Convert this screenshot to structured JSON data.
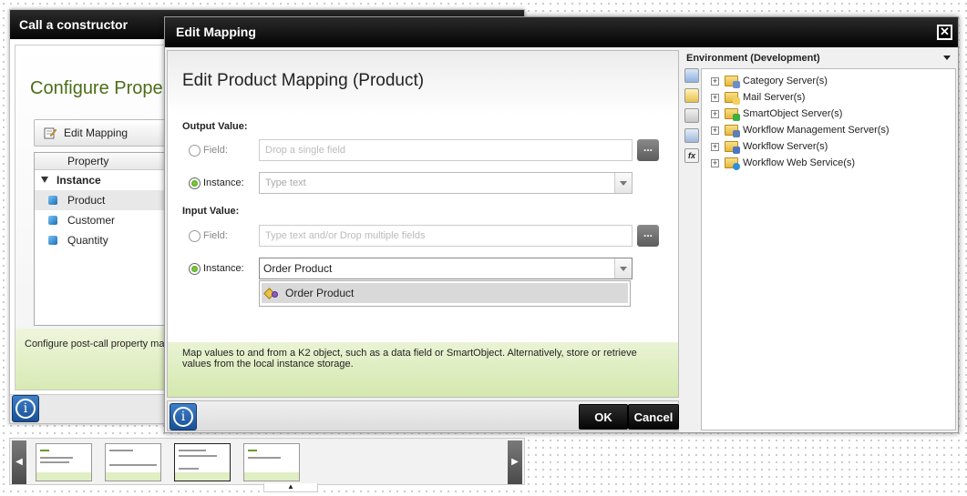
{
  "background_window": {
    "title": "Call a constructor",
    "heading": "Configure Prope",
    "edit_mapping_label": "Edit Mapping",
    "tree_header": "Property",
    "tree_group": "Instance",
    "tree_items": [
      "Product",
      "Customer",
      "Quantity"
    ],
    "footer_text": "Configure post-call property ma"
  },
  "dialog": {
    "title": "Edit Mapping",
    "close_icon": "close-icon",
    "heading": "Edit Product Mapping (Product)",
    "output_section": "Output Value:",
    "input_section": "Input Value:",
    "field_label": "Field:",
    "instance_label": "Instance:",
    "output_field_placeholder": "Drop a single field",
    "output_instance_placeholder": "Type text",
    "input_field_placeholder": "Type text and/or Drop multiple fields",
    "input_instance_value": "Order Product",
    "dropdown_option": "Order Product",
    "ellipsis_label": "...",
    "footer_line1": "Map values to and from a K2 object, such as a data field or SmartObject. Alternatively, store or retrieve",
    "footer_line2": "values from the local instance storage.",
    "ok_label": "OK",
    "cancel_label": "Cancel"
  },
  "environment": {
    "header": "Environment (Development)",
    "tree": [
      {
        "label": "Category Server(s)",
        "badge_color": "#6a8fd0"
      },
      {
        "label": "Mail Server(s)",
        "badge_color": "#f2d060"
      },
      {
        "label": "SmartObject Server(s)",
        "badge_color": "#3fae3f"
      },
      {
        "label": "Workflow Management Server(s)",
        "badge_color": "#5c7fb8"
      },
      {
        "label": "Workflow Server(s)",
        "badge_color": "#4f74c4"
      },
      {
        "label": "Workflow Web Service(s)",
        "badge_color": "#2f8fd8"
      }
    ],
    "toolbar_icons": [
      "environment-icon",
      "fields-icon",
      "context-icon",
      "form-icon",
      "function-icon"
    ],
    "function_icon_text": "fx"
  },
  "info_icon_text": "i",
  "colors": {
    "title_bar": "#050505",
    "heading_green": "#4c6d17",
    "footer_green": "#d4e8ae",
    "radio_selected": "#3c9a10"
  }
}
